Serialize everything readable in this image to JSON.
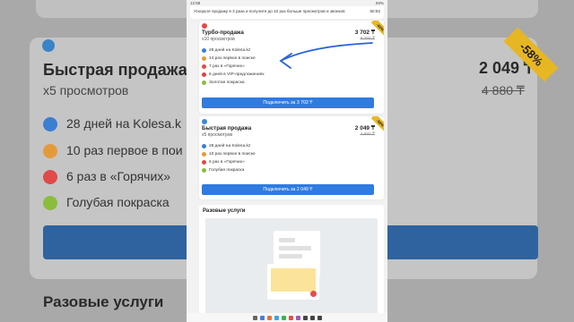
{
  "status": {
    "time": "12:58",
    "battery": "93%"
  },
  "banner": {
    "text": "Ускорьте продажу в 3 раза и получите до 10 раз больше просмотров и звонков",
    "timer": "60:92"
  },
  "turbo": {
    "name": "Турбо-продажа",
    "views": "x10 просмотров",
    "price": "3 702 ₸",
    "old_price": "9 256 ₸",
    "sale": "-60%",
    "features": [
      "28 дней на Kolesa.kz",
      "14 раз первое в поиске",
      "7 раз в «Горячих»",
      "6 дней в VIP-предложениях",
      "Золотая покраска"
    ],
    "button": "Подключить за 3 702 ₸"
  },
  "fast": {
    "name": "Быстрая продажа",
    "views": "x5 просмотров",
    "price": "2 049 ₸",
    "old_price": "4 880 ₸",
    "sale": "-58%",
    "features": [
      "28 дней на Kolesa.kz",
      "10 раз первое в поиске",
      "6 раз в «Горячих»",
      "Голубая покраска"
    ],
    "button": "Подключить за 2 049 ₸"
  },
  "section": {
    "title": "Разовые услуги"
  },
  "background": {
    "title": "Быстрая продажа",
    "views": "x5 просмотров",
    "price": "2 049 ₸",
    "old_price": "4 880 ₸",
    "sale": "-58%",
    "features": [
      "28 дней на Kolesa.k",
      "10 раз первое в пои",
      "6 раз в «Горячих»",
      "Голубая покраска"
    ],
    "section": "Разовые услуги"
  },
  "colors": {
    "accent": "#2f7be0",
    "sale": "#e9b829"
  }
}
